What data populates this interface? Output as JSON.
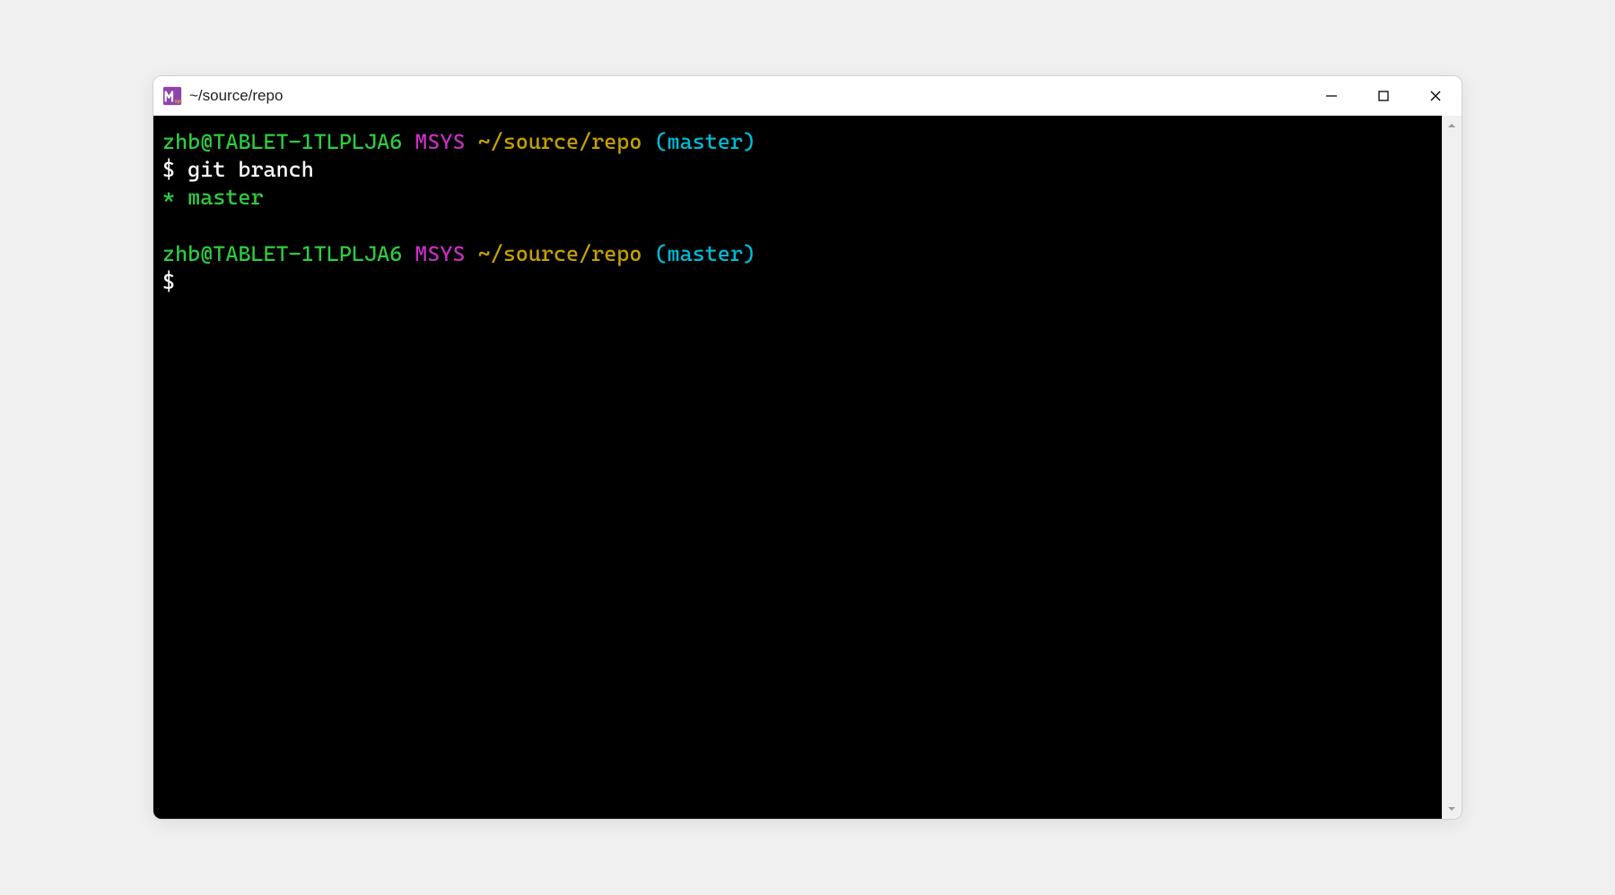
{
  "window": {
    "title": "~/source/repo"
  },
  "prompt1": {
    "user_host": "zhb@TABLET-1TLPLJA6",
    "sys": "MSYS",
    "path": "~/source/repo",
    "branch": "(master)",
    "symbol": "$ ",
    "command": "git branch"
  },
  "output": {
    "marker": "* ",
    "branch_name": "master"
  },
  "prompt2": {
    "user_host": "zhb@TABLET-1TLPLJA6",
    "sys": "MSYS",
    "path": "~/source/repo",
    "branch": "(master)",
    "symbol": "$"
  },
  "colors": {
    "green": "#2ecc40",
    "magenta": "#c930c7",
    "yellow": "#c4a000",
    "cyan": "#00bcd4",
    "white": "#ffffff",
    "bg": "#000000"
  }
}
